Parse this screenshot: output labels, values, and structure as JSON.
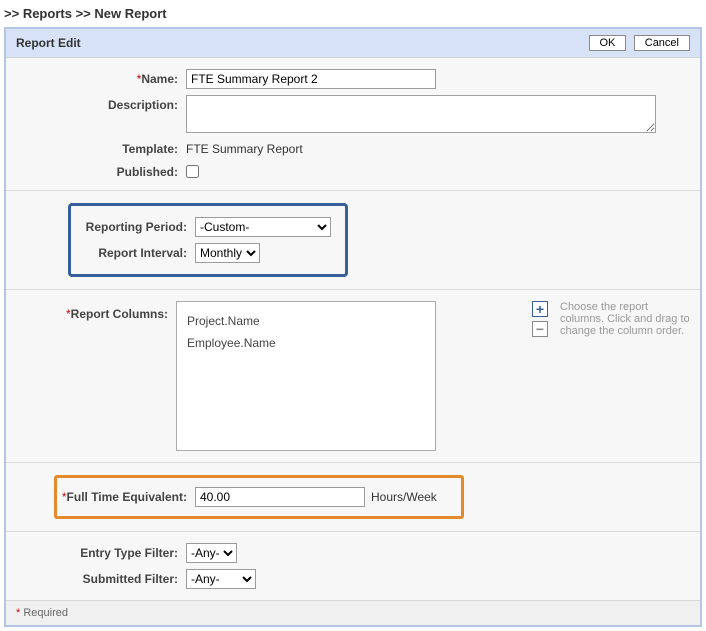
{
  "breadcrumb": {
    "sep1": ">>",
    "part1": "Reports",
    "sep2": ">>",
    "part2": "New Report"
  },
  "header": {
    "title": "Report Edit",
    "ok": "OK",
    "cancel": "Cancel"
  },
  "labels": {
    "name": "Name:",
    "description": "Description:",
    "template": "Template:",
    "published": "Published:",
    "reporting_period": "Reporting Period:",
    "report_interval": "Report Interval:",
    "report_columns": "Report Columns:",
    "fte": "Full Time Equivalent:",
    "entry_type_filter": "Entry Type Filter:",
    "submitted_filter": "Submitted Filter:"
  },
  "values": {
    "name": "FTE Summary Report 2",
    "description": "",
    "template": "FTE Summary Report",
    "reporting_period": "-Custom-",
    "report_interval": "Monthly",
    "fte": "40.00",
    "fte_unit": "Hours/Week",
    "entry_type_filter": "-Any-",
    "submitted_filter": "-Any-"
  },
  "columns": {
    "items": [
      "Project.Name",
      "Employee.Name"
    ],
    "help": "Choose the report columns. Click and drag to change the column order."
  },
  "footer": {
    "asterisk": "*",
    "required": " Required"
  }
}
